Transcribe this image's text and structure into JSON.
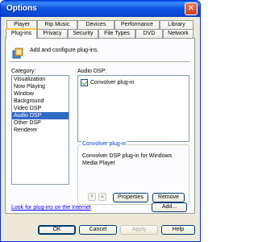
{
  "window": {
    "title": "Options",
    "close_glyph": "✕"
  },
  "tabs_top": [
    {
      "label": "Player"
    },
    {
      "label": "Rip Music"
    },
    {
      "label": "Devices"
    },
    {
      "label": "Performance"
    },
    {
      "label": "Library"
    }
  ],
  "tabs_bottom": [
    {
      "label": "Plug-ins"
    },
    {
      "label": "Privacy"
    },
    {
      "label": "Security"
    },
    {
      "label": "File Types"
    },
    {
      "label": "DVD"
    },
    {
      "label": "Network"
    }
  ],
  "active_tab": "Plug-ins",
  "header": {
    "text": "Add and configure plug-ins.",
    "icon": "plugin-icon"
  },
  "category": {
    "label": "Category:",
    "items": [
      "Visualization",
      "Now Playing",
      "Window",
      "Background",
      "Video DSP",
      "Audio DSP",
      "Other DSP",
      "Renderer"
    ],
    "selected": "Audio DSP"
  },
  "audio_dsp": {
    "label": "Audio DSP:",
    "items": [
      {
        "label": "Convolver plug-in",
        "checked": true
      }
    ]
  },
  "description": {
    "title": "Convolver plug-in",
    "text": "Convolver DSP plug-in for Windows Media Player"
  },
  "controls": {
    "up_glyph": "▲",
    "down_glyph": "▼",
    "properties": "Properties",
    "remove": "Remove",
    "add": "Add...",
    "help_link": "Look for plug-ins on the Internet"
  },
  "footer": {
    "ok": "OK",
    "cancel": "Cancel",
    "apply": "Apply",
    "help": "Help"
  },
  "colors": {
    "selection": "#316ac5",
    "titlebar": "#0a5fe6",
    "link": "#0000ff",
    "group_title": "#0046d5"
  }
}
